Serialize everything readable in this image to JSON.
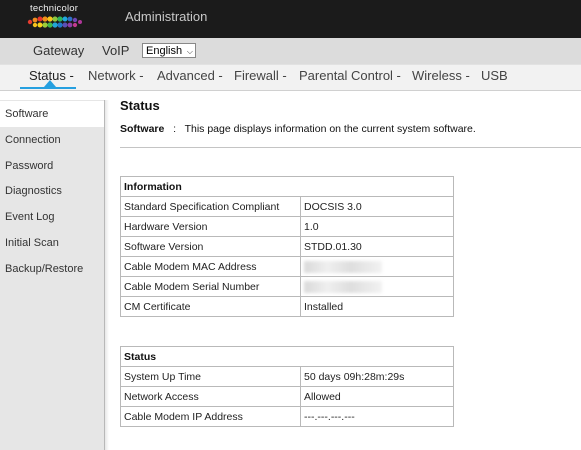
{
  "header": {
    "brand": "technicolor",
    "title": "Administration"
  },
  "subnav": {
    "gateway": "Gateway",
    "voip": "VoIP",
    "language": "English"
  },
  "menu": {
    "items": [
      "Status -",
      "Network -",
      "Advanced -",
      "Firewall -",
      "Parental Control -",
      "Wireless -",
      "USB"
    ],
    "active": "Status -",
    "accent_color": "#26a0e0"
  },
  "sidebar": {
    "items": [
      "Software",
      "Connection",
      "Password",
      "Diagnostics",
      "Event Log",
      "Initial Scan",
      "Backup/Restore"
    ],
    "active": "Software"
  },
  "page": {
    "title": "Status",
    "intro_label": "Software",
    "intro_sep": ":",
    "intro_text": "This page displays information on the current system software."
  },
  "info_table": {
    "header": "Information",
    "rows": [
      {
        "label": "Standard Specification Compliant",
        "value": "DOCSIS 3.0"
      },
      {
        "label": "Hardware Version",
        "value": "1.0"
      },
      {
        "label": "Software Version",
        "value": "STDD.01.30"
      },
      {
        "label": "Cable Modem MAC Address",
        "value": ""
      },
      {
        "label": "Cable Modem Serial Number",
        "value": ""
      },
      {
        "label": "CM Certificate",
        "value": "Installed"
      }
    ]
  },
  "status_table": {
    "header": "Status",
    "rows": [
      {
        "label": "System Up Time",
        "value": "50 days 09h:28m:29s"
      },
      {
        "label": "Network Access",
        "value": "Allowed"
      },
      {
        "label": "Cable Modem IP Address",
        "value": "---.---.---.---"
      }
    ]
  }
}
